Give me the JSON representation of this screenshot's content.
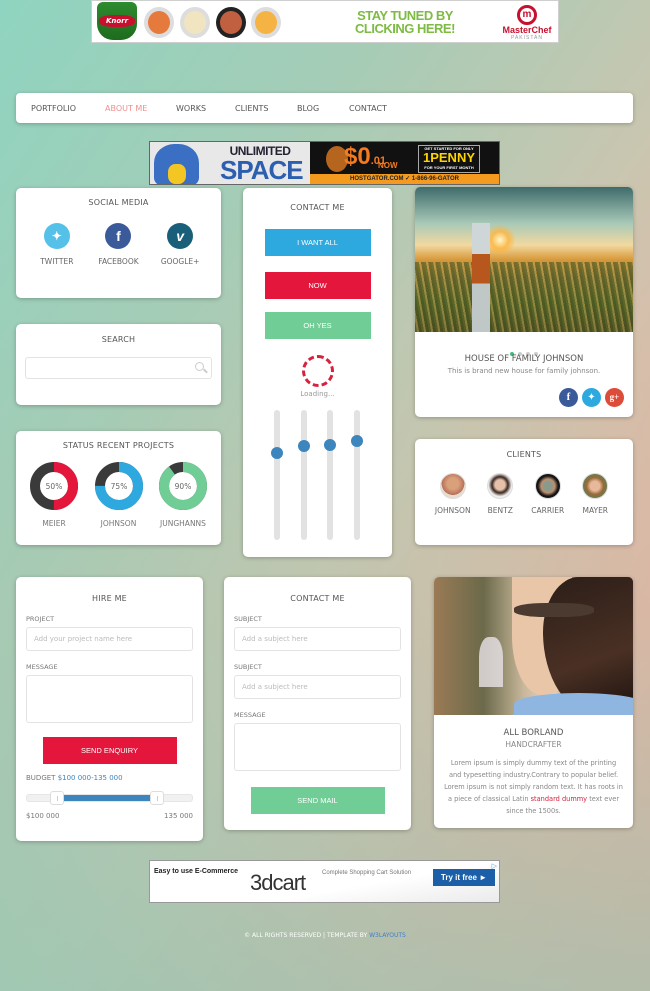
{
  "ads": {
    "top": {
      "brand_left": "Knorr",
      "headline": "STAY TUNED BY CLICKING HERE!",
      "brand_right": "MasterChef",
      "brand_right_sub": "PAKISTAN"
    },
    "middle": {
      "line1": "UNLIMITED",
      "line2": "SPACE",
      "price": "$0",
      "price_cents": ".01",
      "price_suffix": "NOW",
      "promo_top": "GET STARTED FOR ONLY",
      "promo_main": "1PENNY",
      "promo_bottom": "FOR YOUR FIRST MONTH",
      "footer": "HOSTGATOR.COM  ✓  1-866-96-GATOR"
    },
    "bottom": {
      "tagline": "Easy to use E-Commerce",
      "logo": "3dcart",
      "subtitle": "Complete Shopping Cart Solution",
      "cta": "Try it free ►",
      "ad_choices": "▷"
    }
  },
  "nav": {
    "items": [
      {
        "label": "PORTFOLIO",
        "active": false
      },
      {
        "label": "ABOUT ME",
        "active": true
      },
      {
        "label": "WORKS",
        "active": false
      },
      {
        "label": "CLIENTS",
        "active": false
      },
      {
        "label": "BLOG",
        "active": false
      },
      {
        "label": "CONTACT",
        "active": false
      }
    ],
    "active_color": "#ef8f8f"
  },
  "social": {
    "title": "SOCIAL MEDIA",
    "items": [
      {
        "label": "TWITTER",
        "icon": "twitter-icon",
        "glyph": "🐦",
        "color": "#55c0e8"
      },
      {
        "label": "FACEBOOK",
        "icon": "facebook-icon",
        "glyph": "f",
        "color": "#3b5a9a"
      },
      {
        "label": "GOOGLE+",
        "icon": "vimeo-icon",
        "glyph": "v",
        "color": "#1a5f7a"
      }
    ]
  },
  "search": {
    "title": "SEARCH",
    "value": "",
    "placeholder": ""
  },
  "status": {
    "title": "STATUS RECENT PROJECTS",
    "projects": [
      {
        "name": "MEIER",
        "percent": 50,
        "label": "50%",
        "color": "#e4163b"
      },
      {
        "name": "JOHNSON",
        "percent": 75,
        "label": "75%",
        "color": "#2ea9e0"
      },
      {
        "name": "JUNGHANNS",
        "percent": 90,
        "label": "90%",
        "color": "#6fcd95"
      }
    ],
    "track_color": "#3a3a3a"
  },
  "contact_buttons": {
    "title": "CONTACT ME",
    "buttons": [
      {
        "label": "I WANT ALL",
        "color": "#2ea9e0"
      },
      {
        "label": "NOW",
        "color": "#e4163b"
      },
      {
        "label": "OH YES",
        "color": "#6fcd95"
      }
    ],
    "loading_text": "Loading...",
    "sliders": [
      0.67,
      0.72,
      0.73,
      0.76
    ]
  },
  "house": {
    "title": "HOUSE OF FAMILY JOHNSON",
    "subtitle": "This is brand new house for family johnson.",
    "slides": 4,
    "active_slide": 0,
    "share": [
      {
        "icon": "facebook-icon",
        "glyph": "f",
        "color": "#3b5a9a"
      },
      {
        "icon": "twitter-icon",
        "glyph": "t",
        "color": "#2ea9e0"
      },
      {
        "icon": "google-plus-icon",
        "glyph": "g+",
        "color": "#dd4b39"
      }
    ]
  },
  "clients": {
    "title": "CLIENTS",
    "items": [
      {
        "name": "JOHNSON",
        "color": "#b7705a"
      },
      {
        "name": "BENTZ",
        "color": "#4a3530"
      },
      {
        "name": "CARRIER",
        "color": "#2a2a2a"
      },
      {
        "name": "MAYER",
        "color": "#a87a4a"
      }
    ]
  },
  "hire": {
    "title": "HIRE ME",
    "project_label": "PROJECT",
    "project_placeholder": "Add your project name here",
    "project_value": "",
    "message_label": "MESSAGE",
    "message_value": "",
    "send_label": "SEND ENQUIRY",
    "budget_label": "BUDGET",
    "budget_value": "$100 000-135 000",
    "range_min_label": "$100 000",
    "range_max_label": "135 000",
    "range_low": 0.18,
    "range_high": 0.79
  },
  "contact_form": {
    "title": "CONTACT ME",
    "subject1_label": "SUBJECT",
    "subject1_placeholder": "Add a subject here",
    "subject2_label": "SUBJECT",
    "subject2_placeholder": "Add a subject here",
    "message_label": "MESSAGE",
    "send_label": "SEND MAIL"
  },
  "profile": {
    "name": "ALL BORLAND",
    "role": "HANDCRAFTER",
    "bio_before": "Lorem ipsum is simply dummy text of the printing and typesetting industry.Contrary to popular belief. Lorem ipsum is not simply random text. It has roots in a piece of classical Latin ",
    "bio_link": "standard dummy",
    "bio_after": " text ever since the 1500s."
  },
  "footer": {
    "text": "© ALL RIGHTS RESERVED | TEMPLATE BY ",
    "link": "W3LAYOUTS"
  }
}
